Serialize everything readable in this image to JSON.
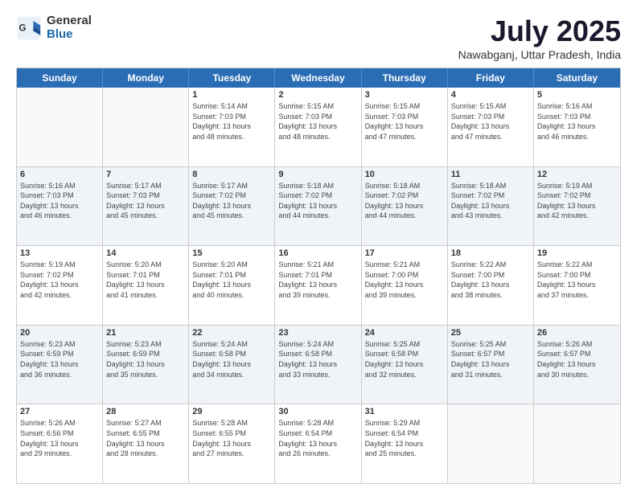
{
  "header": {
    "logo_general": "General",
    "logo_blue": "Blue",
    "title": "July 2025",
    "location": "Nawabganj, Uttar Pradesh, India"
  },
  "calendar": {
    "days_of_week": [
      "Sunday",
      "Monday",
      "Tuesday",
      "Wednesday",
      "Thursday",
      "Friday",
      "Saturday"
    ],
    "rows": [
      [
        {
          "day": "",
          "info": ""
        },
        {
          "day": "",
          "info": ""
        },
        {
          "day": "1",
          "info": "Sunrise: 5:14 AM\nSunset: 7:03 PM\nDaylight: 13 hours\nand 48 minutes."
        },
        {
          "day": "2",
          "info": "Sunrise: 5:15 AM\nSunset: 7:03 PM\nDaylight: 13 hours\nand 48 minutes."
        },
        {
          "day": "3",
          "info": "Sunrise: 5:15 AM\nSunset: 7:03 PM\nDaylight: 13 hours\nand 47 minutes."
        },
        {
          "day": "4",
          "info": "Sunrise: 5:15 AM\nSunset: 7:03 PM\nDaylight: 13 hours\nand 47 minutes."
        },
        {
          "day": "5",
          "info": "Sunrise: 5:16 AM\nSunset: 7:03 PM\nDaylight: 13 hours\nand 46 minutes."
        }
      ],
      [
        {
          "day": "6",
          "info": "Sunrise: 5:16 AM\nSunset: 7:03 PM\nDaylight: 13 hours\nand 46 minutes."
        },
        {
          "day": "7",
          "info": "Sunrise: 5:17 AM\nSunset: 7:03 PM\nDaylight: 13 hours\nand 45 minutes."
        },
        {
          "day": "8",
          "info": "Sunrise: 5:17 AM\nSunset: 7:02 PM\nDaylight: 13 hours\nand 45 minutes."
        },
        {
          "day": "9",
          "info": "Sunrise: 5:18 AM\nSunset: 7:02 PM\nDaylight: 13 hours\nand 44 minutes."
        },
        {
          "day": "10",
          "info": "Sunrise: 5:18 AM\nSunset: 7:02 PM\nDaylight: 13 hours\nand 44 minutes."
        },
        {
          "day": "11",
          "info": "Sunrise: 5:18 AM\nSunset: 7:02 PM\nDaylight: 13 hours\nand 43 minutes."
        },
        {
          "day": "12",
          "info": "Sunrise: 5:19 AM\nSunset: 7:02 PM\nDaylight: 13 hours\nand 42 minutes."
        }
      ],
      [
        {
          "day": "13",
          "info": "Sunrise: 5:19 AM\nSunset: 7:02 PM\nDaylight: 13 hours\nand 42 minutes."
        },
        {
          "day": "14",
          "info": "Sunrise: 5:20 AM\nSunset: 7:01 PM\nDaylight: 13 hours\nand 41 minutes."
        },
        {
          "day": "15",
          "info": "Sunrise: 5:20 AM\nSunset: 7:01 PM\nDaylight: 13 hours\nand 40 minutes."
        },
        {
          "day": "16",
          "info": "Sunrise: 5:21 AM\nSunset: 7:01 PM\nDaylight: 13 hours\nand 39 minutes."
        },
        {
          "day": "17",
          "info": "Sunrise: 5:21 AM\nSunset: 7:00 PM\nDaylight: 13 hours\nand 39 minutes."
        },
        {
          "day": "18",
          "info": "Sunrise: 5:22 AM\nSunset: 7:00 PM\nDaylight: 13 hours\nand 38 minutes."
        },
        {
          "day": "19",
          "info": "Sunrise: 5:22 AM\nSunset: 7:00 PM\nDaylight: 13 hours\nand 37 minutes."
        }
      ],
      [
        {
          "day": "20",
          "info": "Sunrise: 5:23 AM\nSunset: 6:59 PM\nDaylight: 13 hours\nand 36 minutes."
        },
        {
          "day": "21",
          "info": "Sunrise: 5:23 AM\nSunset: 6:59 PM\nDaylight: 13 hours\nand 35 minutes."
        },
        {
          "day": "22",
          "info": "Sunrise: 5:24 AM\nSunset: 6:58 PM\nDaylight: 13 hours\nand 34 minutes."
        },
        {
          "day": "23",
          "info": "Sunrise: 5:24 AM\nSunset: 6:58 PM\nDaylight: 13 hours\nand 33 minutes."
        },
        {
          "day": "24",
          "info": "Sunrise: 5:25 AM\nSunset: 6:58 PM\nDaylight: 13 hours\nand 32 minutes."
        },
        {
          "day": "25",
          "info": "Sunrise: 5:25 AM\nSunset: 6:57 PM\nDaylight: 13 hours\nand 31 minutes."
        },
        {
          "day": "26",
          "info": "Sunrise: 5:26 AM\nSunset: 6:57 PM\nDaylight: 13 hours\nand 30 minutes."
        }
      ],
      [
        {
          "day": "27",
          "info": "Sunrise: 5:26 AM\nSunset: 6:56 PM\nDaylight: 13 hours\nand 29 minutes."
        },
        {
          "day": "28",
          "info": "Sunrise: 5:27 AM\nSunset: 6:55 PM\nDaylight: 13 hours\nand 28 minutes."
        },
        {
          "day": "29",
          "info": "Sunrise: 5:28 AM\nSunset: 6:55 PM\nDaylight: 13 hours\nand 27 minutes."
        },
        {
          "day": "30",
          "info": "Sunrise: 5:28 AM\nSunset: 6:54 PM\nDaylight: 13 hours\nand 26 minutes."
        },
        {
          "day": "31",
          "info": "Sunrise: 5:29 AM\nSunset: 6:54 PM\nDaylight: 13 hours\nand 25 minutes."
        },
        {
          "day": "",
          "info": ""
        },
        {
          "day": "",
          "info": ""
        }
      ]
    ]
  }
}
